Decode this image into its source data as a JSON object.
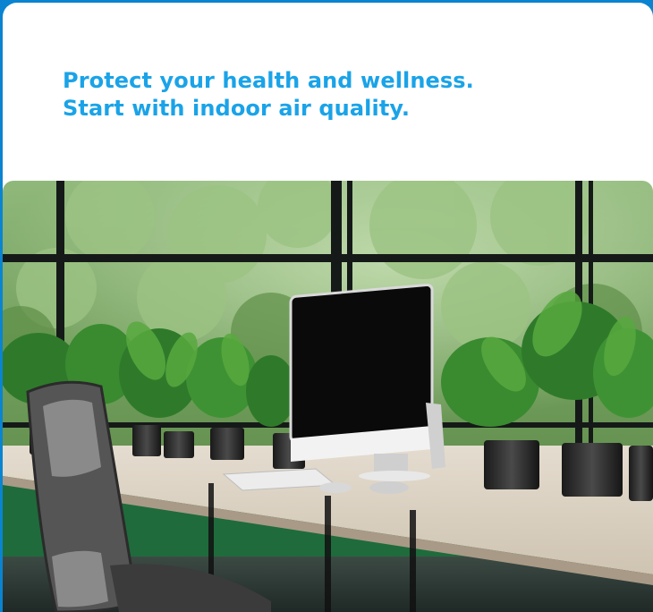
{
  "headline": {
    "line1": "Protect your health and wellness.",
    "line2": "Start with indoor air quality."
  },
  "colors": {
    "frame": "#0a84d0",
    "headline": "#1aa3e8",
    "background": "#ffffff"
  }
}
